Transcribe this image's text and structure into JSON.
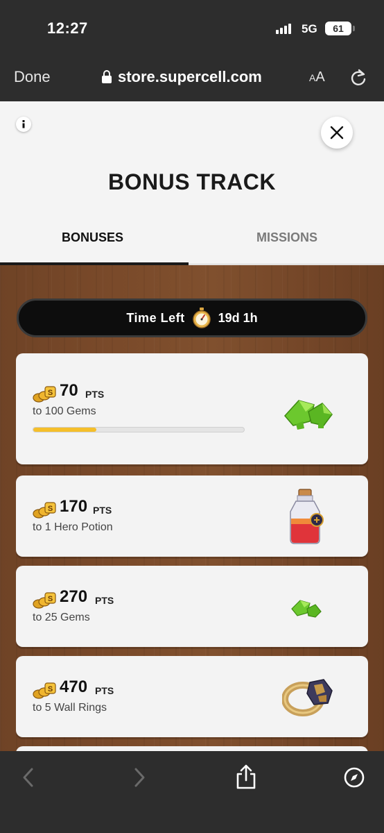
{
  "status": {
    "time": "12:27",
    "network": "5G",
    "battery": "61"
  },
  "browser": {
    "done_label": "Done",
    "url": "store.supercell.com",
    "text_size_label_big": "A",
    "text_size_label_small": "A"
  },
  "modal": {
    "title": "BONUS TRACK",
    "tabs": [
      {
        "label": "BONUSES",
        "active": true
      },
      {
        "label": "MISSIONS",
        "active": false
      }
    ]
  },
  "timer": {
    "label": "Time Left",
    "value": "19d 1h"
  },
  "bonuses": [
    {
      "points": "70",
      "unit": "PTS",
      "reward": "to 100 Gems",
      "progress": 0.3,
      "icon": "gems-icon"
    },
    {
      "points": "170",
      "unit": "PTS",
      "reward": "to 1 Hero Potion",
      "icon": "hero-potion-icon"
    },
    {
      "points": "270",
      "unit": "PTS",
      "reward": "to 25 Gems",
      "icon": "gems-icon"
    },
    {
      "points": "470",
      "unit": "PTS",
      "reward": "to 5 Wall Rings",
      "icon": "wall-ring-icon"
    }
  ],
  "colors": {
    "progress": "#f5bf2a",
    "wood": "#7a4a2a",
    "card": "#f3f3f3"
  }
}
